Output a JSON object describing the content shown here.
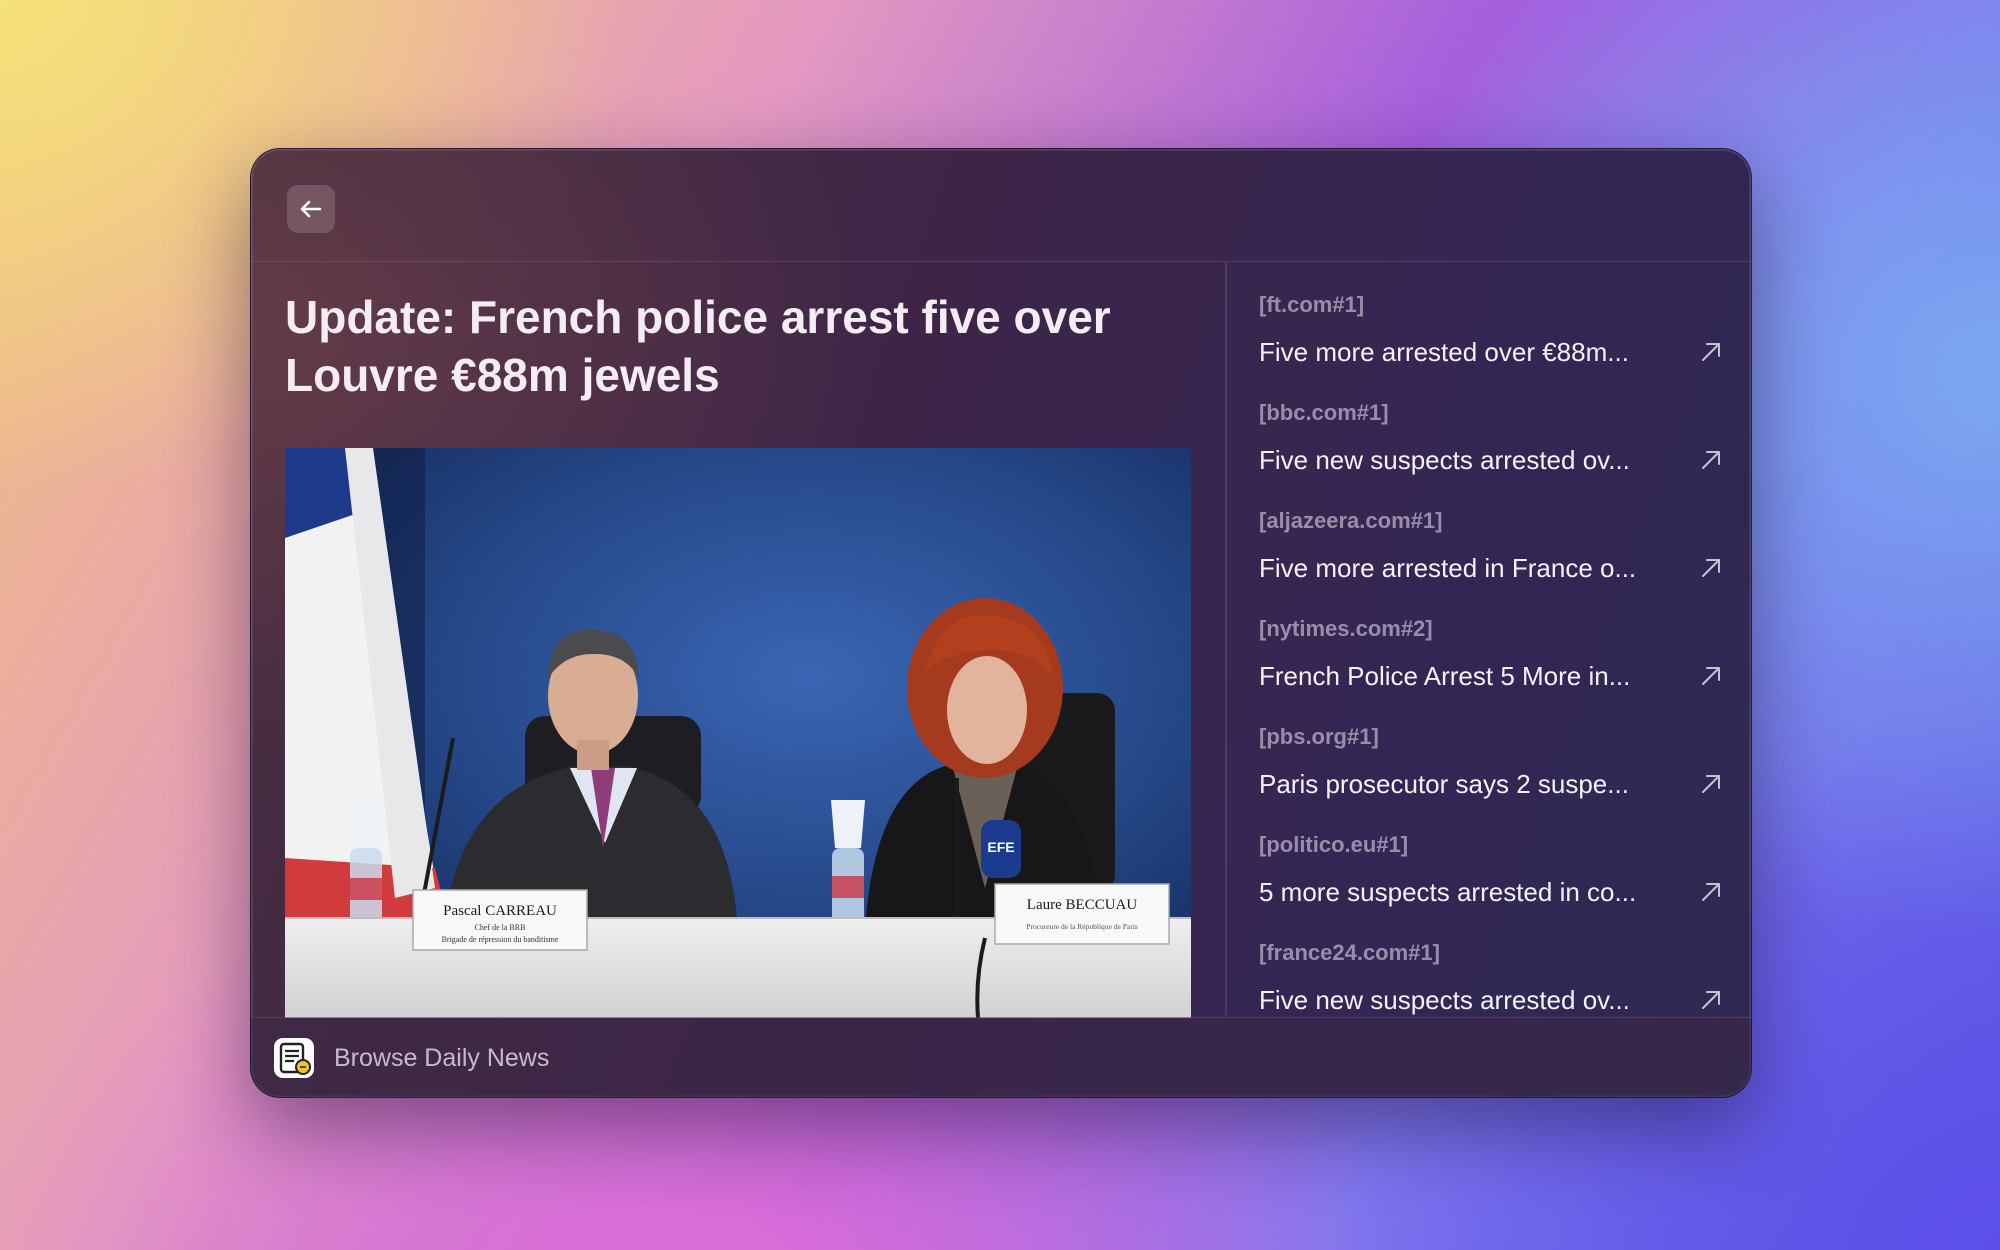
{
  "colors": {
    "window_bg": "#3b2748",
    "title_text": "#f4eef4",
    "source_tag_text": "#a89bb0",
    "headline_text": "#f6f1f6"
  },
  "header": {
    "back_icon": "arrow-left-icon"
  },
  "article": {
    "title": "Update: French police arrest five over Louvre €88m jewels",
    "image": {
      "nameplate_left": "Pascal CARREAU",
      "nameplate_left_sub1": "Chef de la BRB",
      "nameplate_left_sub2": "Brigade de répression du banditisme",
      "nameplate_right": "Laure BECCUAU",
      "nameplate_right_sub": "Procureure de la République de Paris",
      "mic_brand": "EFE"
    }
  },
  "sources": [
    {
      "tag": "[ft.com#1]",
      "headline": "Five more arrested over €88m...",
      "icon": "external-link-arrow-icon"
    },
    {
      "tag": "[bbc.com#1]",
      "headline": "Five new suspects arrested ov...",
      "icon": "external-link-arrow-icon"
    },
    {
      "tag": "[aljazeera.com#1]",
      "headline": "Five more arrested in France o...",
      "icon": "external-link-arrow-icon"
    },
    {
      "tag": "[nytimes.com#2]",
      "headline": "French Police Arrest 5 More in...",
      "icon": "external-link-arrow-icon"
    },
    {
      "tag": "[pbs.org#1]",
      "headline": "Paris prosecutor says 2 suspe...",
      "icon": "external-link-arrow-icon"
    },
    {
      "tag": "[politico.eu#1]",
      "headline": "5 more suspects arrested in co...",
      "icon": "external-link-arrow-icon"
    },
    {
      "tag": "[france24.com#1]",
      "headline": "Five new suspects arrested ov...",
      "icon": "external-link-arrow-icon"
    }
  ],
  "footer": {
    "app_icon": "newspaper-icon",
    "label": "Browse Daily News"
  }
}
